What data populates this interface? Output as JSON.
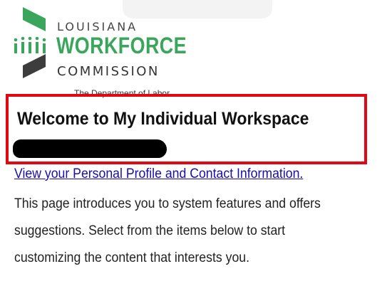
{
  "logo": {
    "line1": "LOUISIANA",
    "line2": "WORKFORCE",
    "line3": "COMMISSION",
    "colors": {
      "green": "#3aa65b",
      "dark": "#333333"
    }
  },
  "header": {
    "tagline": "The Department of Labor"
  },
  "welcome": {
    "title": "Welcome to My Individual Workspace",
    "highlight_color": "#e30613"
  },
  "profile_link": "View your Personal Profile and Contact Information.",
  "intro": {
    "lines": [
      "This page introduces you to system features and offers",
      "suggestions. Select from the items below to start",
      "customizing the content that interests you."
    ]
  }
}
